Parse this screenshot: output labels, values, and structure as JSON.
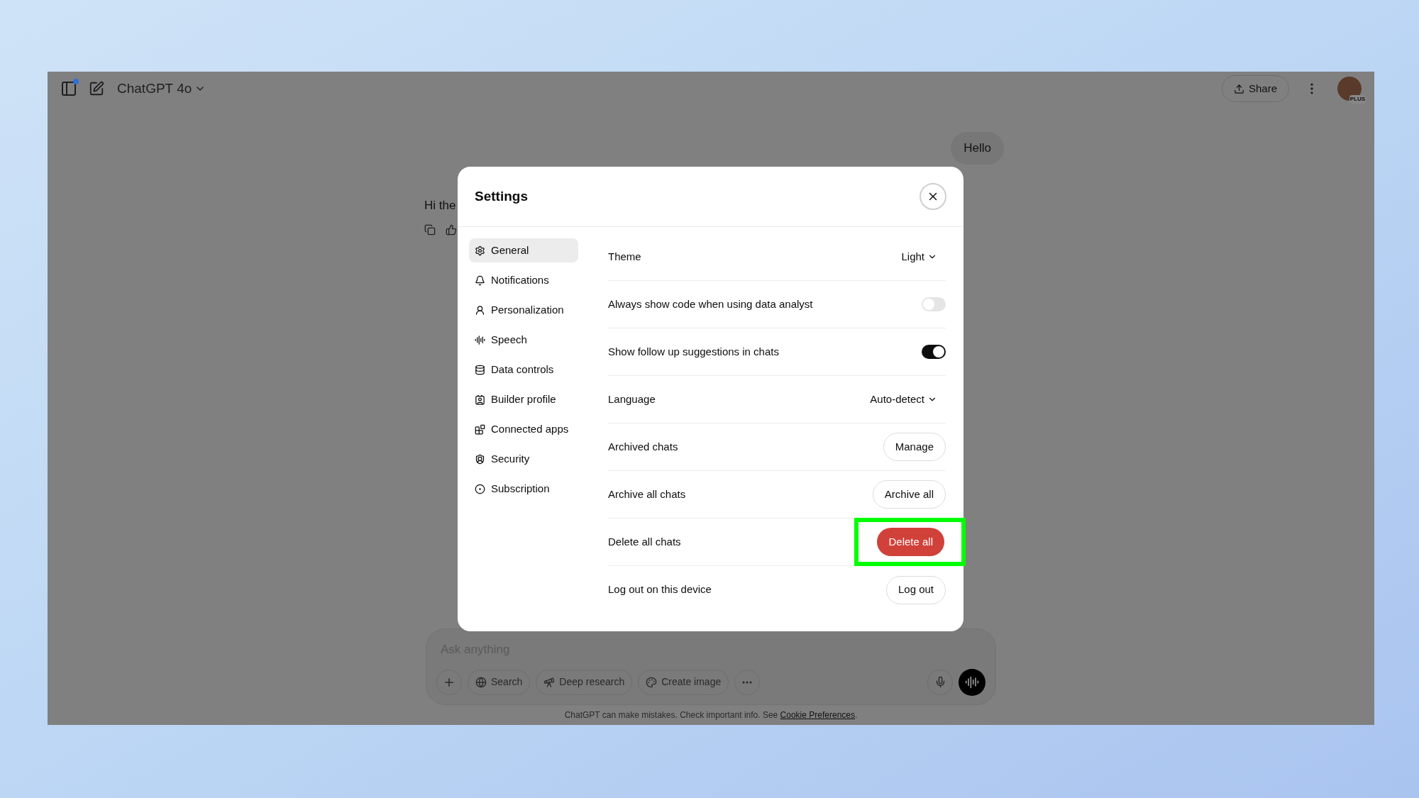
{
  "topbar": {
    "title": "ChatGPT 4o",
    "share": "Share",
    "avatar_badge": "PLUS",
    "sidebar_dot": true
  },
  "user_message": "Hello",
  "assistant_message": "Hi the",
  "settings": {
    "title": "Settings",
    "nav": [
      {
        "label": "General",
        "selected": true
      },
      {
        "label": "Notifications",
        "selected": false
      },
      {
        "label": "Personalization",
        "selected": false
      },
      {
        "label": "Speech",
        "selected": false
      },
      {
        "label": "Data controls",
        "selected": false
      },
      {
        "label": "Builder profile",
        "selected": false
      },
      {
        "label": "Connected apps",
        "selected": false
      },
      {
        "label": "Security",
        "selected": false
      },
      {
        "label": "Subscription",
        "selected": false
      }
    ],
    "rows": [
      {
        "kind": "select",
        "label": "Theme",
        "value": "Light"
      },
      {
        "kind": "toggle",
        "label": "Always show code when using data analyst",
        "on": false
      },
      {
        "kind": "toggle",
        "label": "Show follow up suggestions in chats",
        "on": true
      },
      {
        "kind": "select",
        "label": "Language",
        "value": "Auto-detect"
      },
      {
        "kind": "button",
        "label": "Archived chats",
        "button": "Manage",
        "danger": false,
        "highlighted": false
      },
      {
        "kind": "button",
        "label": "Archive all chats",
        "button": "Archive all",
        "danger": false,
        "highlighted": false
      },
      {
        "kind": "button",
        "label": "Delete all chats",
        "button": "Delete all",
        "danger": true,
        "highlighted": true
      },
      {
        "kind": "button",
        "label": "Log out on this device",
        "button": "Log out",
        "danger": false,
        "highlighted": false
      }
    ]
  },
  "composer": {
    "placeholder": "Ask anything",
    "tools": [
      "Search",
      "Deep research",
      "Create image"
    ]
  },
  "footer": {
    "text": "ChatGPT can make mistakes. Check important info. See ",
    "link": "Cookie Preferences",
    "end": "."
  }
}
